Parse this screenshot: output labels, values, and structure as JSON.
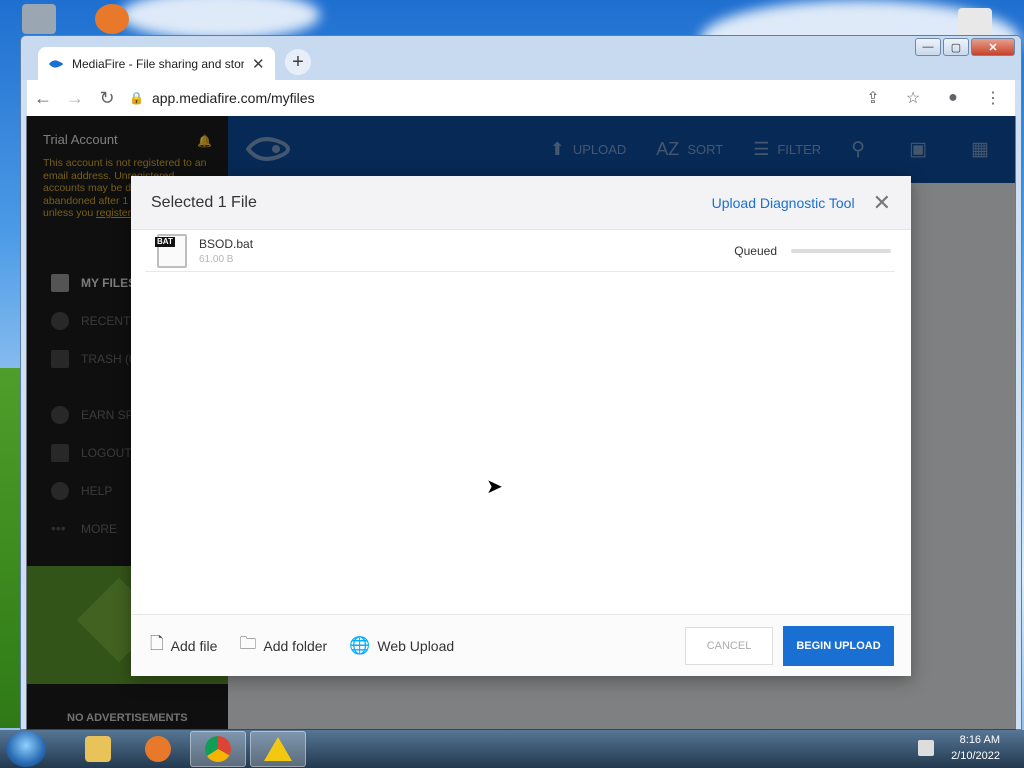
{
  "browser": {
    "tab_title": "MediaFire - File sharing and stora",
    "tab_close": "✕",
    "new_tab": "+",
    "url": "app.mediafire.com/myfiles",
    "nav": {
      "back": "←",
      "forward": "→",
      "reload": "↻"
    },
    "win_buttons": {
      "minimize": "—",
      "maximize": "▢",
      "close": "✕"
    }
  },
  "sidebar": {
    "account_title": "Trial Account",
    "notice_text": "This account is not registered to an email address. Unregistered accounts may be deleted if abandoned after 1 year of inactivity, unless you",
    "notice_link": "register. Register",
    "items": [
      {
        "label": "MY FILES"
      },
      {
        "label": "RECENT F"
      },
      {
        "label": "TRASH (0"
      },
      {
        "label": "EARN SPA"
      },
      {
        "label": "LOGOUT"
      },
      {
        "label": "HELP"
      },
      {
        "label": "MORE"
      }
    ],
    "no_ads": "NO ADVERTISEMENTS"
  },
  "appbar": {
    "upload": "UPLOAD",
    "sort": "SORT",
    "filter": "FILTER"
  },
  "modal": {
    "title": "Selected 1 File",
    "diagnostic_link": "Upload Diagnostic Tool",
    "close": "✕",
    "file": {
      "badge": "BAT",
      "name": "BSOD.bat",
      "size": "61.00 B",
      "status": "Queued",
      "progress": 0
    },
    "footer": {
      "add_file": "Add file",
      "add_folder": "Add folder",
      "web_upload": "Web Upload",
      "cancel": "CANCEL",
      "begin_upload": "BEGIN UPLOAD"
    }
  },
  "taskbar": {
    "time": "8:16 AM",
    "date": "2/10/2022"
  },
  "colors": {
    "accent": "#1a6fd2",
    "appbar": "#0d4c9b",
    "sidebar": "#1c1c1c",
    "warning": "#d8ab2a"
  }
}
